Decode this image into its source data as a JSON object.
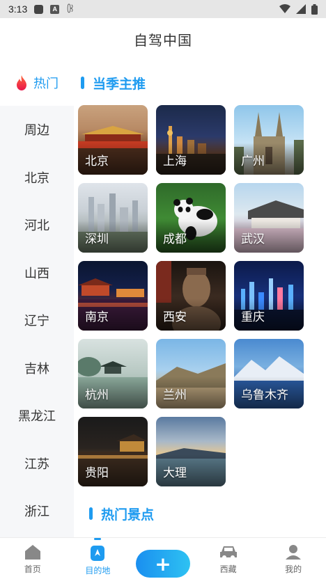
{
  "status": {
    "time": "3:13",
    "glyph": "ꀝ"
  },
  "header": {
    "title": "自驾中国"
  },
  "sidebar": {
    "items": [
      {
        "label": "热门"
      },
      {
        "label": "周边"
      },
      {
        "label": "北京"
      },
      {
        "label": "河北"
      },
      {
        "label": "山西"
      },
      {
        "label": "辽宁"
      },
      {
        "label": "吉林"
      },
      {
        "label": "黑龙江"
      },
      {
        "label": "江苏"
      },
      {
        "label": "浙江"
      }
    ]
  },
  "main": {
    "section1": "当季主推",
    "section2": "热门景点",
    "cities": [
      {
        "label": "北京"
      },
      {
        "label": "上海"
      },
      {
        "label": "广州"
      },
      {
        "label": "深圳"
      },
      {
        "label": "成都"
      },
      {
        "label": "武汉"
      },
      {
        "label": "南京"
      },
      {
        "label": "西安"
      },
      {
        "label": "重庆"
      },
      {
        "label": "杭州"
      },
      {
        "label": "兰州"
      },
      {
        "label": "乌鲁木齐"
      },
      {
        "label": "贵阳"
      },
      {
        "label": "大理"
      }
    ]
  },
  "tabbar": {
    "tabs": [
      {
        "label": "首页"
      },
      {
        "label": "目的地"
      },
      {
        "label": "+"
      },
      {
        "label": "西藏"
      },
      {
        "label": "我的"
      }
    ]
  },
  "colors": {
    "accent": "#1e9bf0"
  }
}
